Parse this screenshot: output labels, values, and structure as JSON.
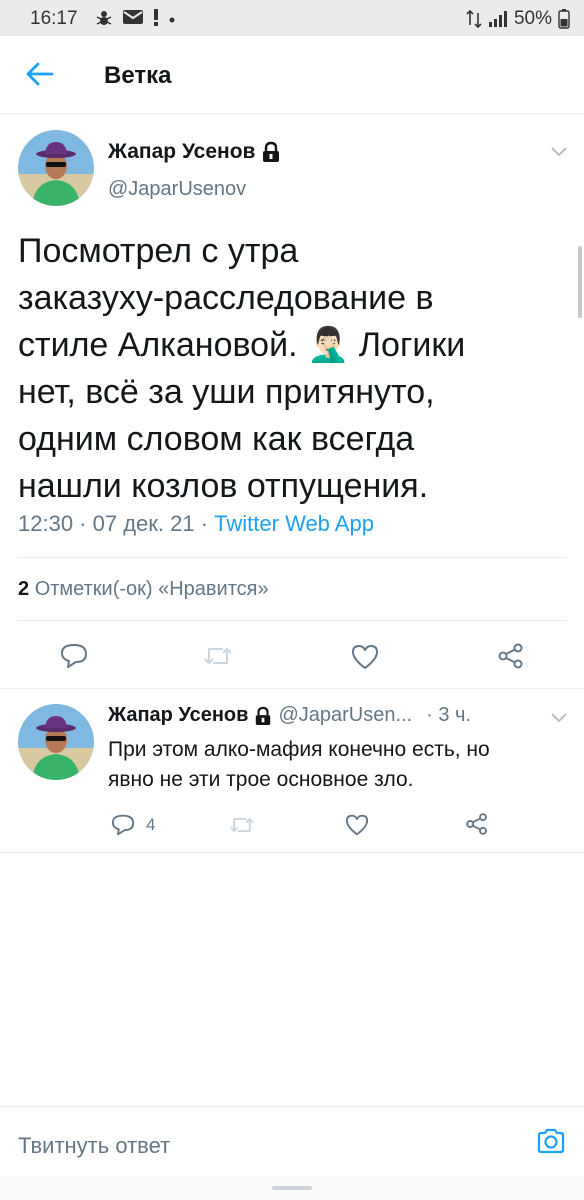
{
  "status_bar": {
    "time": "16:17",
    "notification_icons": [
      "spider-icon",
      "mail-icon",
      "alert-icon",
      "dot-icon"
    ],
    "signal_icons": [
      "data-arrows-icon",
      "signal-bars-icon"
    ],
    "battery": "50%"
  },
  "header": {
    "title": "Ветка",
    "back_icon": "arrow-left-icon"
  },
  "main_tweet": {
    "author_name": "Жапар Усенов",
    "handle": "@JaparUsenov",
    "protected_icon": "lock-icon",
    "text_lines": [
      "Посмотрел с утра",
      "заказуху-расследование в",
      "стиле Алкановой. 🤦🏻‍♂️ Логики",
      "нет, всё за уши притянуто,",
      "одним словом как всегда",
      "нашли козлов отпущения."
    ],
    "time": "12:30",
    "date": "07 дек. 21",
    "separator": " · ",
    "source": "Twitter Web App",
    "likes_count": "2",
    "likes_label": "Отметки(-ок) «Нравится»",
    "actions": [
      "reply-icon",
      "retweet-icon",
      "like-icon",
      "share-icon"
    ]
  },
  "reply_tweet": {
    "author_name": "Жапар Усенов",
    "handle": "@JaparUsen...",
    "time": "· 3 ч.",
    "text_lines": [
      "При этом алко-мафия конечно есть, но",
      "явно не эти трое основное зло."
    ],
    "reply_count": "4",
    "actions": [
      "reply-icon",
      "retweet-icon",
      "like-icon",
      "share-icon"
    ]
  },
  "compose": {
    "placeholder": "Твитнуть ответ",
    "camera_icon": "camera-icon"
  },
  "colors": {
    "accent": "#1da1f2",
    "secondary_text": "#657786",
    "primary_text": "#14171a",
    "divider": "#e6ecf0",
    "status_bar_bg": "#ebebeb"
  }
}
